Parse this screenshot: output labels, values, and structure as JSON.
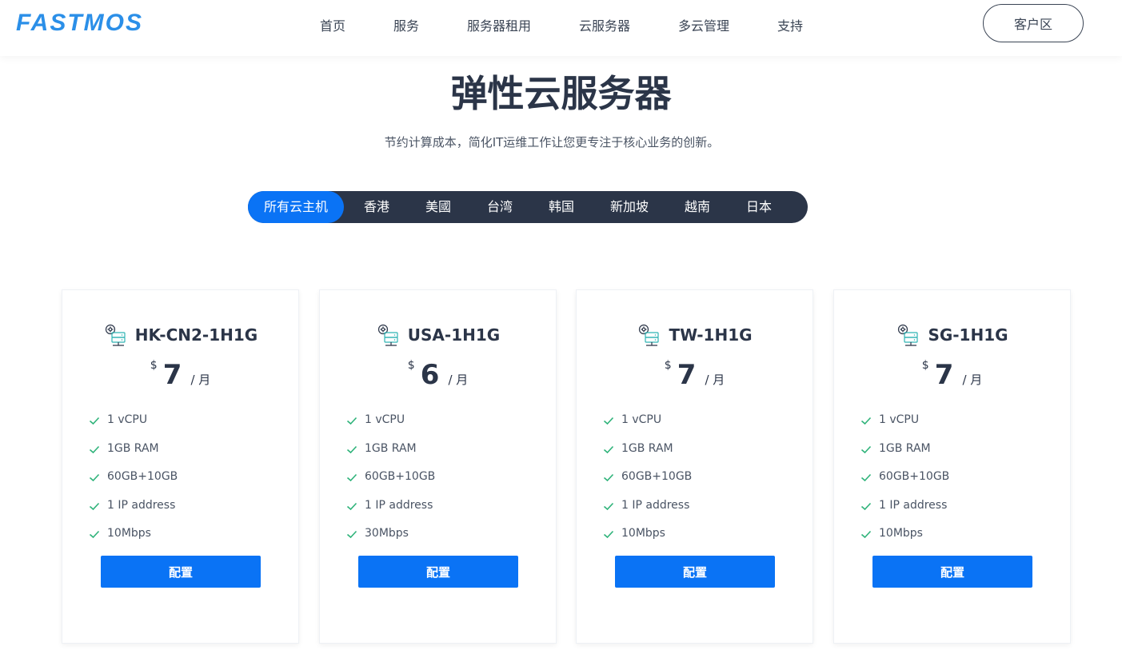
{
  "header": {
    "logo": "FASTMOS",
    "nav": [
      "首页",
      "服务",
      "服务器租用",
      "云服务器",
      "多云管理",
      "支持"
    ],
    "client_button": "客户区"
  },
  "hero": {
    "title": "弹性云服务器",
    "subtitle": "节约计算成本，简化IT运维工作让您更专注于核心业务的创新。"
  },
  "tabs": {
    "items": [
      "所有云主机",
      "香港",
      "美國",
      "台湾",
      "韩国",
      "新加坡",
      "越南",
      "日本"
    ],
    "active": "所有云主机"
  },
  "colors": {
    "accent": "#0a73f5",
    "dark": "#2b3548",
    "check": "#2fb37a",
    "logo": "#2b8fe8"
  },
  "plans": [
    {
      "name": "HK-CN2-1H1G",
      "currency": "$",
      "price": "7",
      "unit": "/ 月",
      "specs": [
        "1 vCPU",
        "1GB RAM",
        "60GB+10GB",
        "1 IP address",
        "10Mbps"
      ],
      "button": "配置"
    },
    {
      "name": "USA-1H1G",
      "currency": "$",
      "price": "6",
      "unit": "/ 月",
      "specs": [
        "1 vCPU",
        "1GB RAM",
        "60GB+10GB",
        "1 IP address",
        "30Mbps"
      ],
      "button": "配置"
    },
    {
      "name": "TW-1H1G",
      "currency": "$",
      "price": "7",
      "unit": "/ 月",
      "specs": [
        "1 vCPU",
        "1GB RAM",
        "60GB+10GB",
        "1 IP address",
        "10Mbps"
      ],
      "button": "配置"
    },
    {
      "name": "SG-1H1G",
      "currency": "$",
      "price": "7",
      "unit": "/ 月",
      "specs": [
        "1 vCPU",
        "1GB RAM",
        "60GB+10GB",
        "1 IP address",
        "10Mbps"
      ],
      "button": "配置"
    }
  ]
}
